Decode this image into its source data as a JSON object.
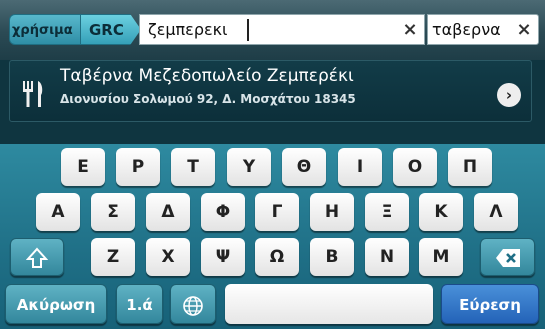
{
  "search": {
    "crumb_partial": "χρήσιμα",
    "crumb_country": "GRC",
    "query": "ζεμπερεκι",
    "category": "ταβερνα",
    "clear_symbol": "×"
  },
  "result": {
    "title": "Ταβέρνα Μεζεδοπωλείο Ζεμπερέκι",
    "address": "Διονυσίου Σολωμού 92, Δ. Μοσχάτου 18345",
    "go_symbol": "›"
  },
  "keyboard": {
    "row1": [
      "Ε",
      "Ρ",
      "Τ",
      "Υ",
      "Θ",
      "Ι",
      "Ο",
      "Π"
    ],
    "row2": [
      "Α",
      "Σ",
      "Δ",
      "Φ",
      "Γ",
      "Η",
      "Ξ",
      "Κ",
      "Λ"
    ],
    "row3": [
      "Ζ",
      "Χ",
      "Ψ",
      "Ω",
      "Β",
      "Ν",
      "Μ"
    ],
    "cancel": "Ακύρωση",
    "numbers": "1.ά",
    "search": "Εύρεση"
  }
}
